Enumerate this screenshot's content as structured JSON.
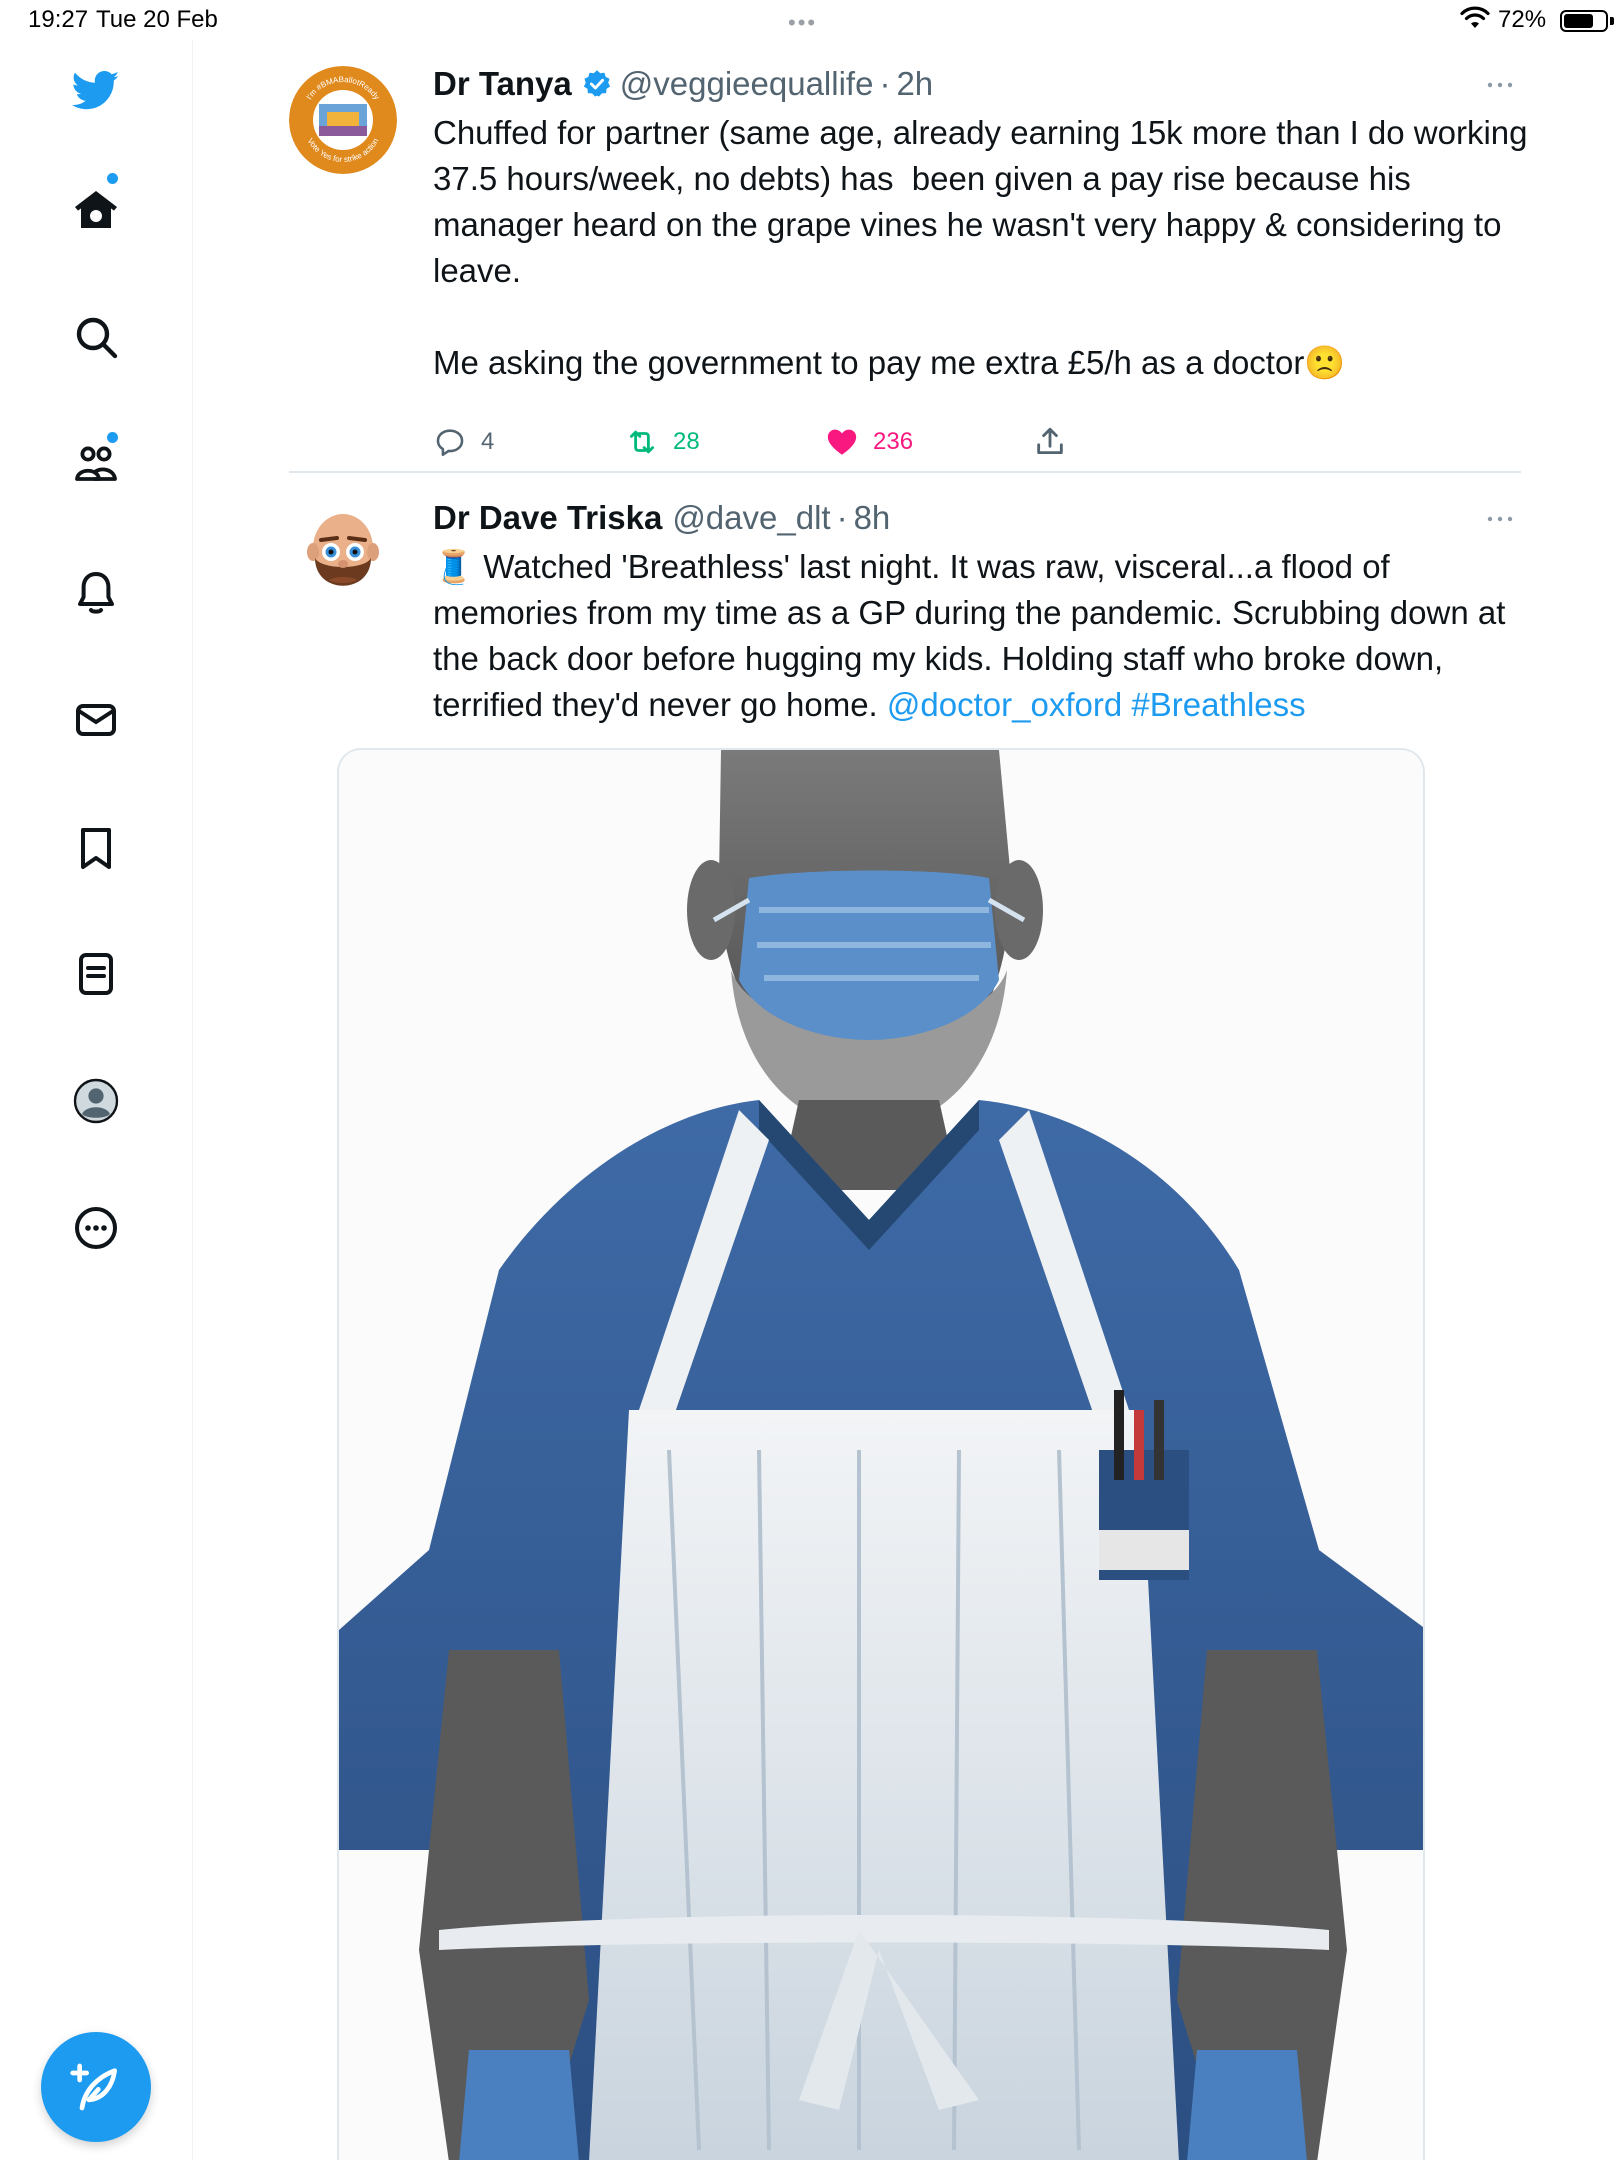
{
  "status_bar": {
    "time": "19:27",
    "date": "Tue 20 Feb",
    "battery_percent": "72%",
    "battery_level": 0.72
  },
  "sidebar": {
    "items": [
      {
        "name": "twitter-logo",
        "icon": "bird-icon"
      },
      {
        "name": "home",
        "icon": "home-icon",
        "has_notification": true
      },
      {
        "name": "explore",
        "icon": "search-icon"
      },
      {
        "name": "communities",
        "icon": "communities-icon",
        "has_notification": true
      },
      {
        "name": "notifications",
        "icon": "bell-icon"
      },
      {
        "name": "messages",
        "icon": "envelope-icon"
      },
      {
        "name": "bookmarks",
        "icon": "bookmark-icon"
      },
      {
        "name": "lists",
        "icon": "list-icon"
      },
      {
        "name": "profile",
        "icon": "profile-avatar-icon"
      },
      {
        "name": "more",
        "icon": "more-circle-icon"
      }
    ],
    "compose_icon": "compose-feather-icon",
    "accent_color": "#1d9bf0"
  },
  "tweets": [
    {
      "author": "Dr Tanya",
      "verified": true,
      "handle": "@veggieequallife",
      "separator": "·",
      "time": "2h",
      "text": "Chuffed for partner (same age, already earning 15k more than I do working 37.5 hours/week, no debts) has  been given a pay rise because his manager heard on the grape vines he wasn't very happy & considering to leave.\n\nMe asking the government to pay me extra £5/h as a doctor",
      "emoji": "🙁",
      "avatar_text_top": "I'm #BMABallotReady",
      "avatar_text_bottom": "Vote Yes for strike action",
      "replies": "4",
      "retweets": "28",
      "likes": "236",
      "liked": true,
      "retweeted": true
    },
    {
      "author": "Dr Dave Triska",
      "verified": false,
      "handle": "@dave_dlt",
      "separator": "·",
      "time": "8h",
      "emoji": "🧵",
      "text": " Watched 'Breathless' last night. It was raw, visceral...a flood of memories from my time as a GP during the pandemic. Scrubbing down at the back door before hugging my kids. Holding staff who broke down, terrified they'd never go home. ",
      "mention": "@doctor_oxford",
      "hashtag": "#Breathless",
      "media_icon": "doctor-illustration-image"
    }
  ],
  "colors": {
    "like": "#f91880",
    "retweet": "#00ba7c",
    "link": "#1d9bf0",
    "secondary_text": "#536471"
  }
}
